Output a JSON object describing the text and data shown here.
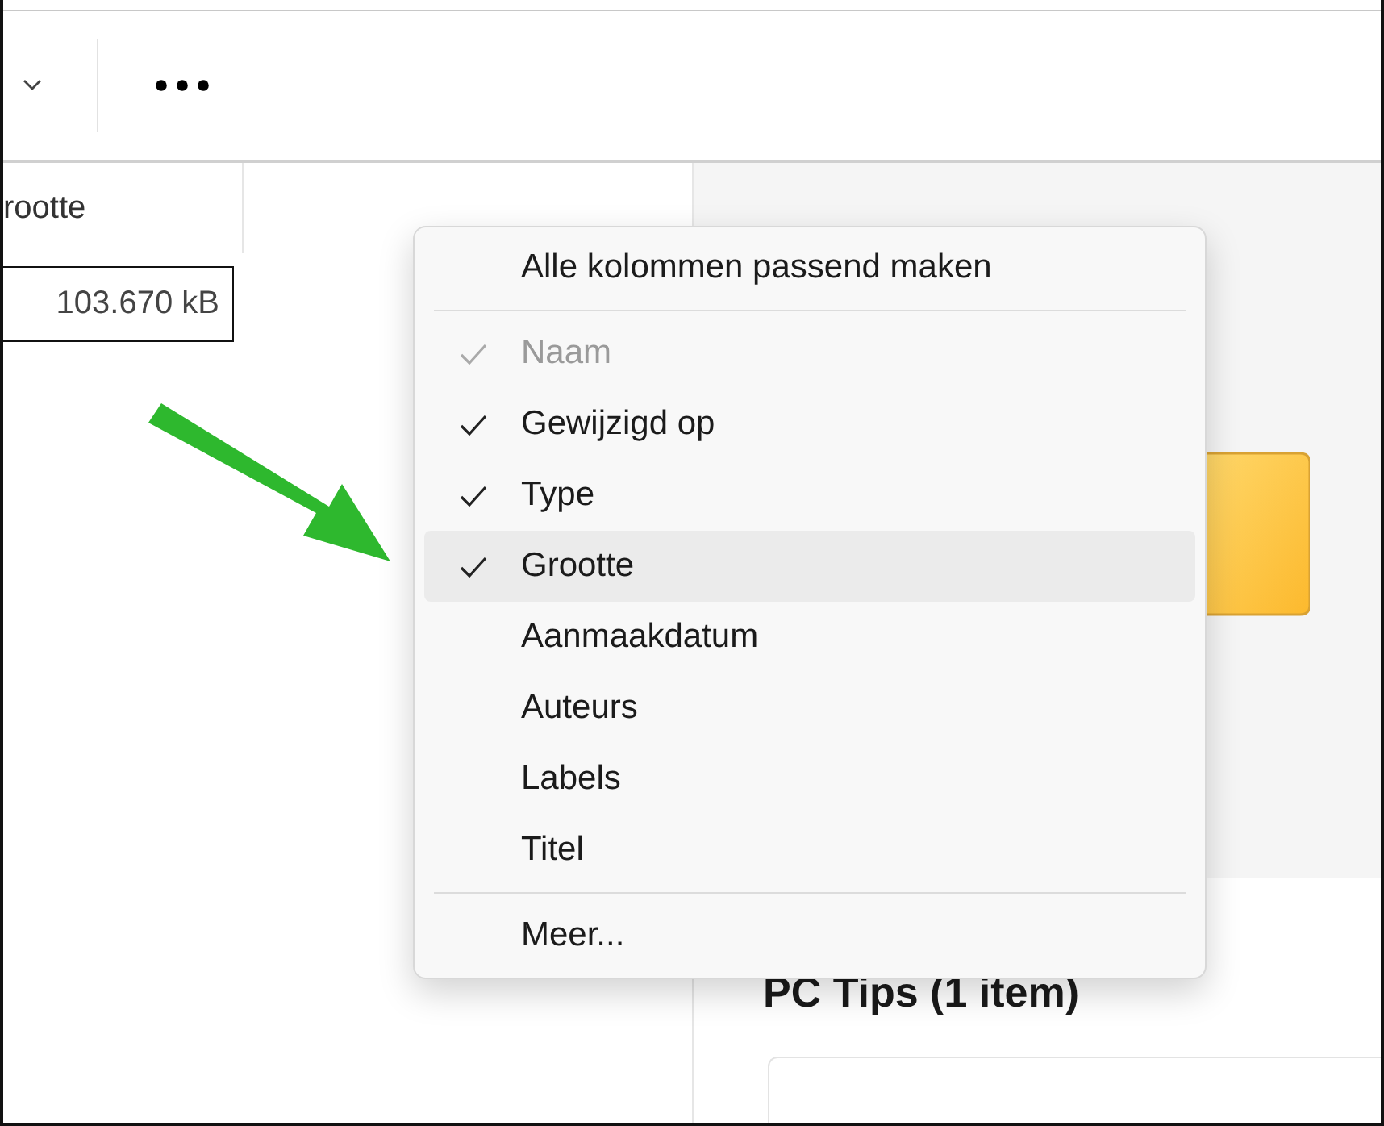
{
  "list": {
    "column_header": "rootte",
    "size_cell": "103.670 kB"
  },
  "details": {
    "title": "PC Tips (1 item)"
  },
  "menu": {
    "items": [
      {
        "kind": "action",
        "label": "Alle kolommen passend maken"
      },
      {
        "kind": "separator"
      },
      {
        "kind": "column",
        "label": "Naam",
        "checked": true,
        "disabled": true,
        "selected": false
      },
      {
        "kind": "column",
        "label": "Gewijzigd op",
        "checked": true,
        "disabled": false,
        "selected": false
      },
      {
        "kind": "column",
        "label": "Type",
        "checked": true,
        "disabled": false,
        "selected": false
      },
      {
        "kind": "column",
        "label": "Grootte",
        "checked": true,
        "disabled": false,
        "selected": true
      },
      {
        "kind": "column",
        "label": "Aanmaakdatum",
        "checked": false,
        "disabled": false,
        "selected": false
      },
      {
        "kind": "column",
        "label": "Auteurs",
        "checked": false,
        "disabled": false,
        "selected": false
      },
      {
        "kind": "column",
        "label": "Labels",
        "checked": false,
        "disabled": false,
        "selected": false
      },
      {
        "kind": "column",
        "label": "Titel",
        "checked": false,
        "disabled": false,
        "selected": false
      },
      {
        "kind": "separator"
      },
      {
        "kind": "action",
        "label": "Meer..."
      }
    ]
  }
}
